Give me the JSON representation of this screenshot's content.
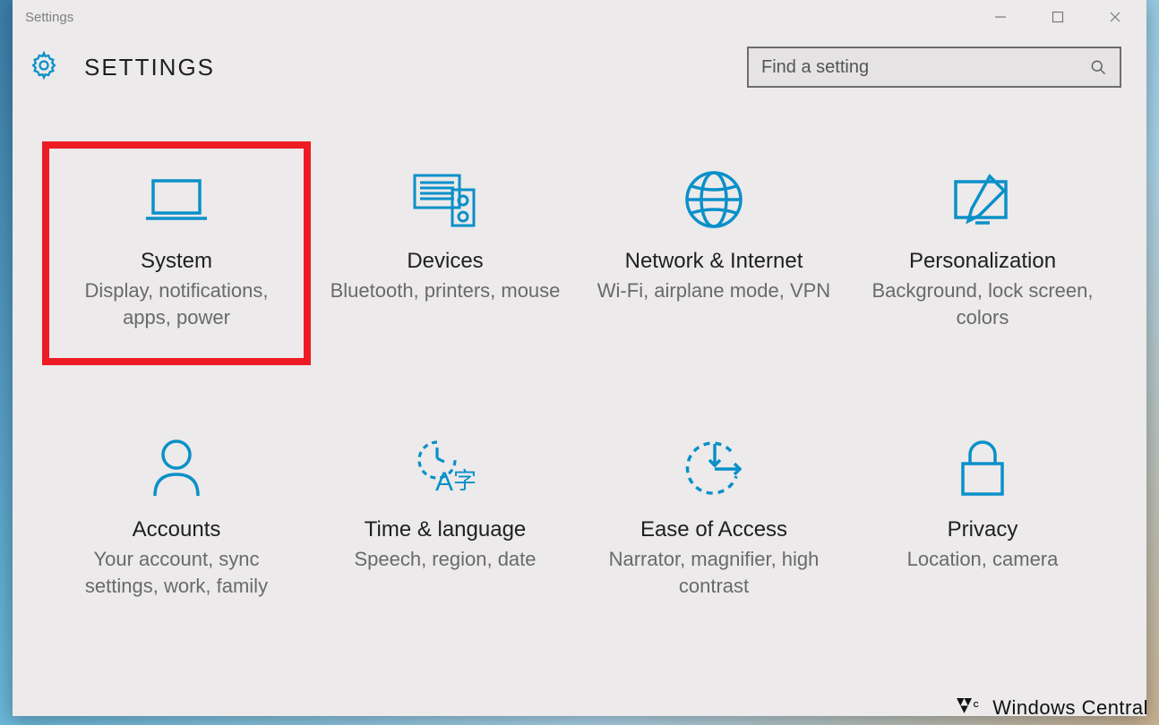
{
  "window": {
    "title": "Settings"
  },
  "header": {
    "title": "SETTINGS"
  },
  "search": {
    "placeholder": "Find a setting"
  },
  "categories": [
    {
      "id": "system",
      "title": "System",
      "desc": "Display, notifications, apps, power",
      "highlighted": true
    },
    {
      "id": "devices",
      "title": "Devices",
      "desc": "Bluetooth, printers, mouse",
      "highlighted": false
    },
    {
      "id": "network",
      "title": "Network & Internet",
      "desc": "Wi-Fi, airplane mode, VPN",
      "highlighted": false
    },
    {
      "id": "personalization",
      "title": "Personalization",
      "desc": "Background, lock screen, colors",
      "highlighted": false
    },
    {
      "id": "accounts",
      "title": "Accounts",
      "desc": "Your account, sync settings, work, family",
      "highlighted": false
    },
    {
      "id": "time-language",
      "title": "Time & language",
      "desc": "Speech, region, date",
      "highlighted": false
    },
    {
      "id": "ease-of-access",
      "title": "Ease of Access",
      "desc": "Narrator, magnifier, high contrast",
      "highlighted": false
    },
    {
      "id": "privacy",
      "title": "Privacy",
      "desc": "Location, camera",
      "highlighted": false
    }
  ],
  "watermark": "Windows Central",
  "annotation": {
    "highlighted_category": "system",
    "highlight_color": "#ed1c24"
  }
}
